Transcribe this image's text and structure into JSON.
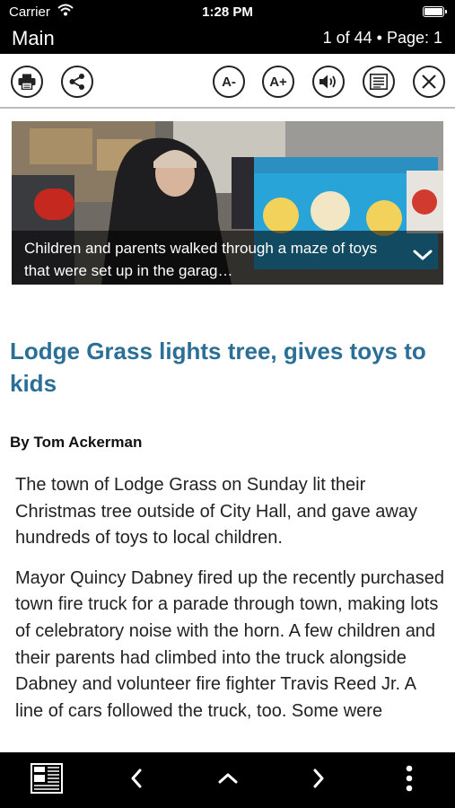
{
  "status_bar": {
    "carrier": "Carrier",
    "time": "1:28 PM"
  },
  "nav": {
    "title": "Main",
    "page_info": "1 of 44 • Page: 1"
  },
  "toolbar": {
    "buttons": [
      {
        "icon": "printer-icon"
      },
      {
        "icon": "share-icon"
      },
      {
        "label": "A-"
      },
      {
        "label": "A+"
      },
      {
        "icon": "speaker-icon"
      },
      {
        "icon": "article-view-icon"
      },
      {
        "icon": "close-icon"
      }
    ]
  },
  "hero": {
    "caption": "Children and parents walked through a maze of toys that were set up in the garag…"
  },
  "article": {
    "headline": "Lodge Grass lights tree, gives toys to kids",
    "byline": "By Tom Ackerman",
    "paragraphs": [
      "The town of Lodge Grass on Sunday lit their Christmas tree outside of City Hall, and gave away hundreds of toys to local children.",
      "Mayor Quincy Dabney fired up the recently purchased town fire truck for a parade through town, making lots of celebratory noise with the horn. A few children and their parents had climbed into the truck alongside Dabney and volunteer fire fighter Travis Reed Jr. A line of cars followed the truck, too. Some were"
    ]
  },
  "bottom_bar": {
    "icons": [
      "newspaper-icon",
      "chevron-left-icon",
      "chevron-up-icon",
      "chevron-right-icon",
      "more-vertical-icon"
    ]
  },
  "colors": {
    "headline": "#2b6f96",
    "bars": "#000000"
  }
}
